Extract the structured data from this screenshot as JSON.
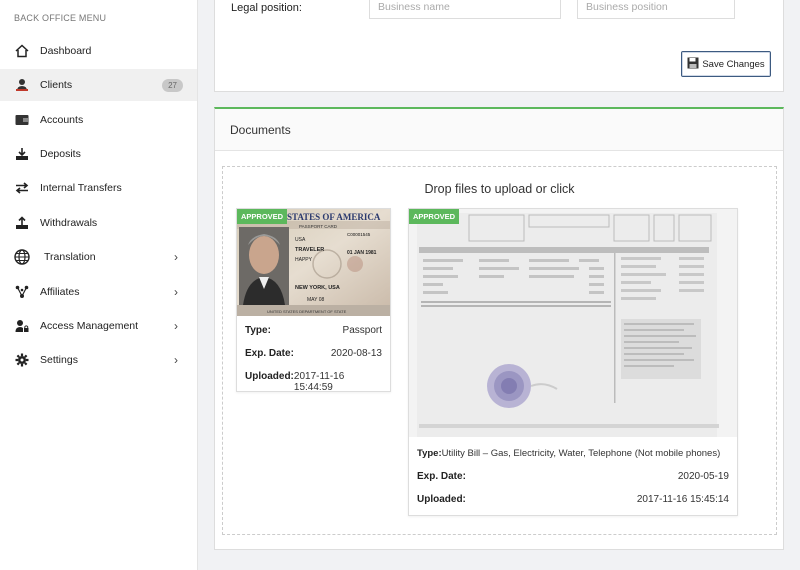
{
  "sidebar": {
    "title": "BACK OFFICE MENU",
    "items": [
      {
        "label": "Dashboard",
        "icon": "home-icon"
      },
      {
        "label": "Clients",
        "icon": "user-icon",
        "badge": "27"
      },
      {
        "label": "Accounts",
        "icon": "wallet-icon"
      },
      {
        "label": "Deposits",
        "icon": "download-tray-icon"
      },
      {
        "label": "Internal Transfers",
        "icon": "transfer-arrows-icon"
      },
      {
        "label": "Withdrawals",
        "icon": "upload-tray-icon"
      },
      {
        "label": "Translation",
        "icon": "globe-icon"
      },
      {
        "label": "Affiliates",
        "icon": "network-icon"
      },
      {
        "label": "Access Management",
        "icon": "user-lock-icon"
      },
      {
        "label": "Settings",
        "icon": "gear-icon"
      }
    ]
  },
  "legal": {
    "label": "Legal position:",
    "business_name_placeholder": "Business name",
    "business_position_placeholder": "Business position",
    "save_label": "Save Changes"
  },
  "documents": {
    "title": "Documents",
    "drop_text": "Drop files to upload or click",
    "cards": [
      {
        "status": "APPROVED",
        "type_label": "Type:",
        "type_value": "Passport",
        "exp_label": "Exp. Date:",
        "exp_value": "2020-08-13",
        "uploaded_label": "Uploaded:",
        "uploaded_value": "2017-11-16 15:44:59",
        "thumb_text": {
          "header": "STATES OF AMERICA",
          "sub": "PASSPORT CARD",
          "nat": "USA",
          "surname": "TRAVELER",
          "given": "HAPPY",
          "dob": "01 JAN 1981",
          "place": "NEW YORK, USA",
          "exp": "MAY 08",
          "footer": "UNITED STATES DEPARTMENT OF STATE",
          "number": "C00001545"
        }
      },
      {
        "status": "APPROVED",
        "type_label": "Type:",
        "type_value": "Utility Bill – Gas, Electricity, Water, Telephone (Not mobile phones)",
        "exp_label": "Exp. Date:",
        "exp_value": "2020-05-19",
        "uploaded_label": "Uploaded:",
        "uploaded_value": "2017-11-16 15:45:14"
      }
    ]
  },
  "colors": {
    "approved": "#5cb85c",
    "docs_border": "#5cb85c",
    "save_border": "#3d5a80"
  }
}
